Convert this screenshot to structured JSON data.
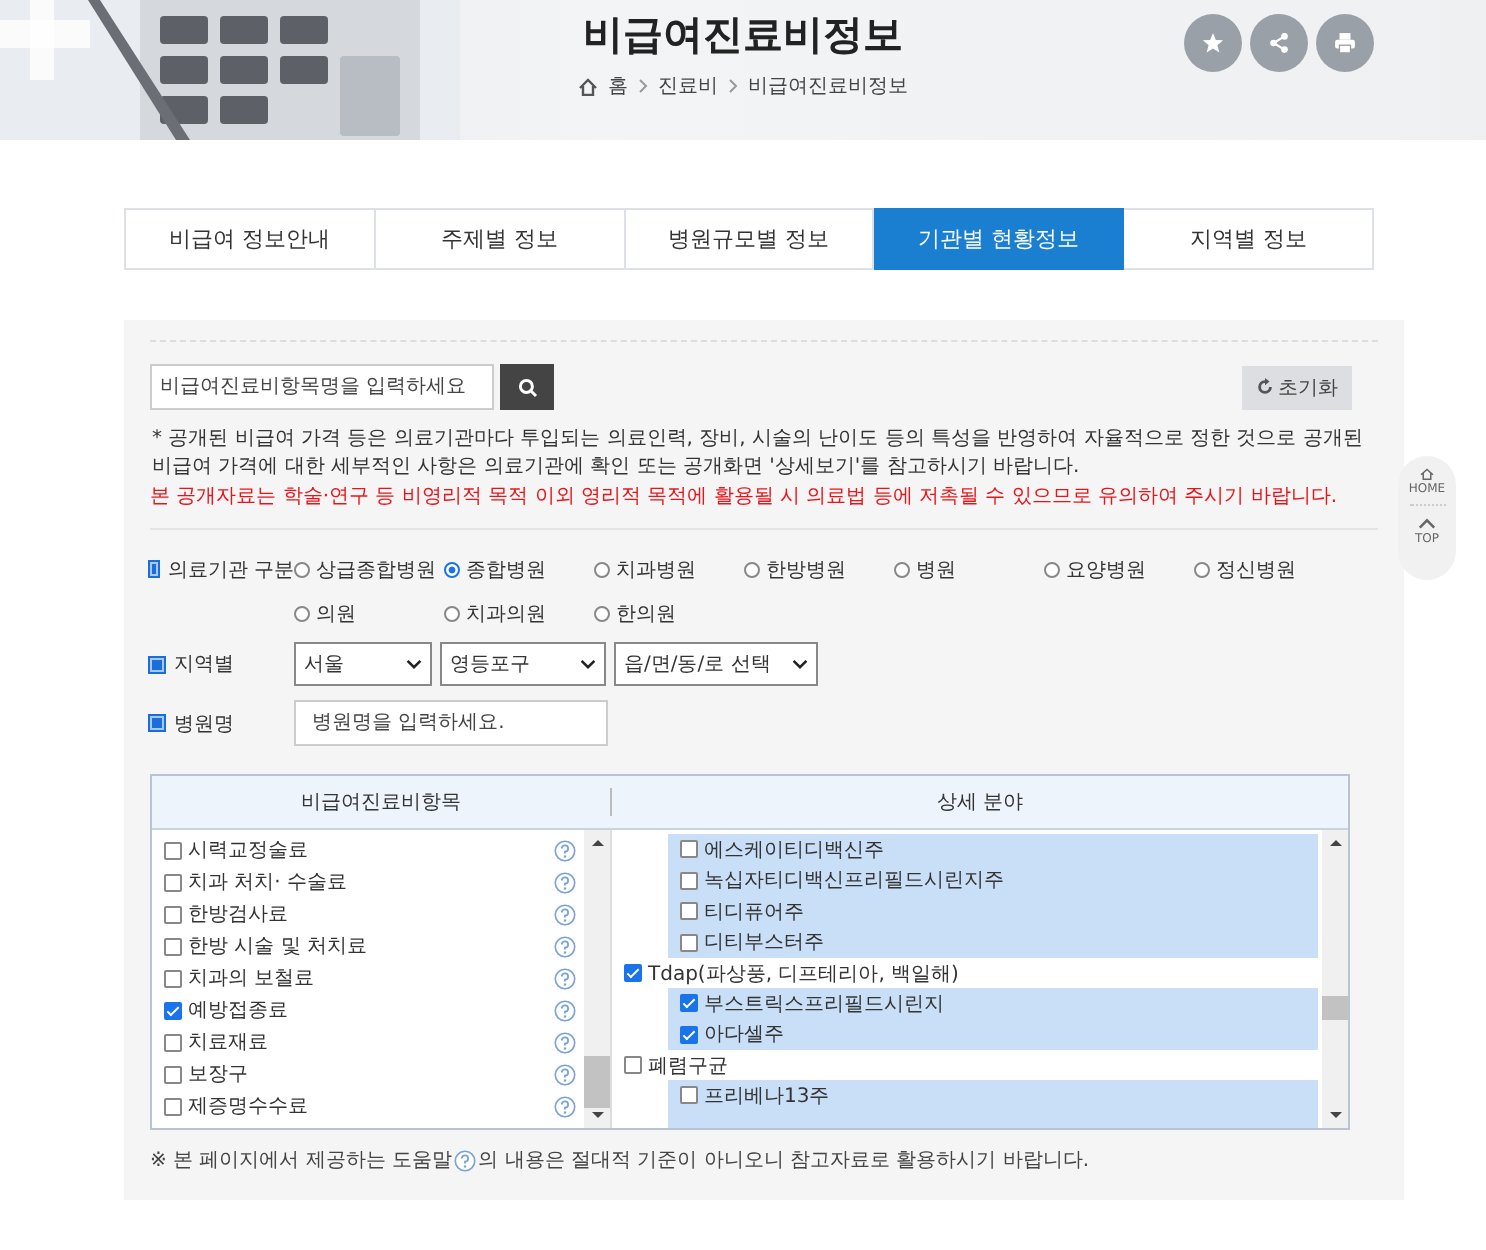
{
  "header": {
    "title": "비급여진료비정보",
    "breadcrumb": [
      "홈",
      "진료비",
      "비급여진료비정보"
    ]
  },
  "tabs": [
    {
      "label": "비급여 정보안내",
      "selected": false
    },
    {
      "label": "주제별 정보",
      "selected": false
    },
    {
      "label": "병원규모별 정보",
      "selected": false
    },
    {
      "label": "기관별 현황정보",
      "selected": true
    },
    {
      "label": "지역별 정보",
      "selected": false
    }
  ],
  "search": {
    "placeholder": "비급여진료비항목명을 입력하세요",
    "reset_label": "초기화"
  },
  "notes": [
    "* 공개된 비급여 가격 등은 의료기관마다 투입되는 의료인력, 장비, 시술의 난이도 등의 특성을 반영하여 자율적으로 정한 것으로 공개된 비급여 가격에 대한 세부적인 사항은 의료기관에 확인 또는 공개화면 '상세보기'를 참고하시기 바랍니다."
  ],
  "warning": "본 공개자료는 학술·연구 등 비영리적 목적 이외 영리적 목적에 활용될 시 의료법 등에 저촉될 수 있으므로 유의하여 주시기 바랍니다.",
  "filters": {
    "type_label": "의료기관 구분",
    "types": [
      {
        "label": "상급종합병원",
        "selected": false
      },
      {
        "label": "종합병원",
        "selected": true
      },
      {
        "label": "치과병원",
        "selected": false
      },
      {
        "label": "한방병원",
        "selected": false
      },
      {
        "label": "병원",
        "selected": false
      },
      {
        "label": "요양병원",
        "selected": false
      },
      {
        "label": "정신병원",
        "selected": false
      },
      {
        "label": "의원",
        "selected": false
      },
      {
        "label": "치과의원",
        "selected": false
      },
      {
        "label": "한의원",
        "selected": false
      }
    ],
    "region_label": "지역별",
    "regions": [
      "서울",
      "영등포구",
      "읍/면/동/로 선택"
    ],
    "name_label": "병원명",
    "name_placeholder": "병원명을 입력하세요."
  },
  "table": {
    "columns": [
      "비급여진료비항목",
      "상세 분야"
    ],
    "items": [
      {
        "label": "시력교정술료",
        "checked": false
      },
      {
        "label": "치과 처치· 수술료",
        "checked": false
      },
      {
        "label": "한방검사료",
        "checked": false
      },
      {
        "label": "한방 시술 및 처치료",
        "checked": false
      },
      {
        "label": "치과의 보철료",
        "checked": false
      },
      {
        "label": "예방접종료",
        "checked": true
      },
      {
        "label": "치료재료",
        "checked": false
      },
      {
        "label": "보장구",
        "checked": false
      },
      {
        "label": "제증명수수료",
        "checked": false
      }
    ],
    "details": [
      {
        "children": [
          {
            "label": "에스케이티디백신주",
            "checked": false
          },
          {
            "label": "녹십자티디백신프리필드시린지주",
            "checked": false
          },
          {
            "label": "티디퓨어주",
            "checked": false
          },
          {
            "label": "디티부스터주",
            "checked": false
          }
        ]
      },
      {
        "label": "Tdap(파상풍, 디프테리아, 백일해)",
        "checked": true,
        "children": [
          {
            "label": "부스트릭스프리필드시린지",
            "checked": true
          },
          {
            "label": "아다셀주",
            "checked": true
          }
        ]
      },
      {
        "label": "폐렴구균",
        "checked": false,
        "children": [
          {
            "label": "프리베나13주",
            "checked": false
          },
          {
            "kind": "cut"
          }
        ]
      }
    ]
  },
  "footnote": [
    "※ 본 페이지에서 제공하는 도움말",
    "의 내용은 절대적 기준이 아니오니 참고자료로 활용하시기 바랍니다."
  ],
  "side": [
    "HOME",
    "TOP"
  ]
}
